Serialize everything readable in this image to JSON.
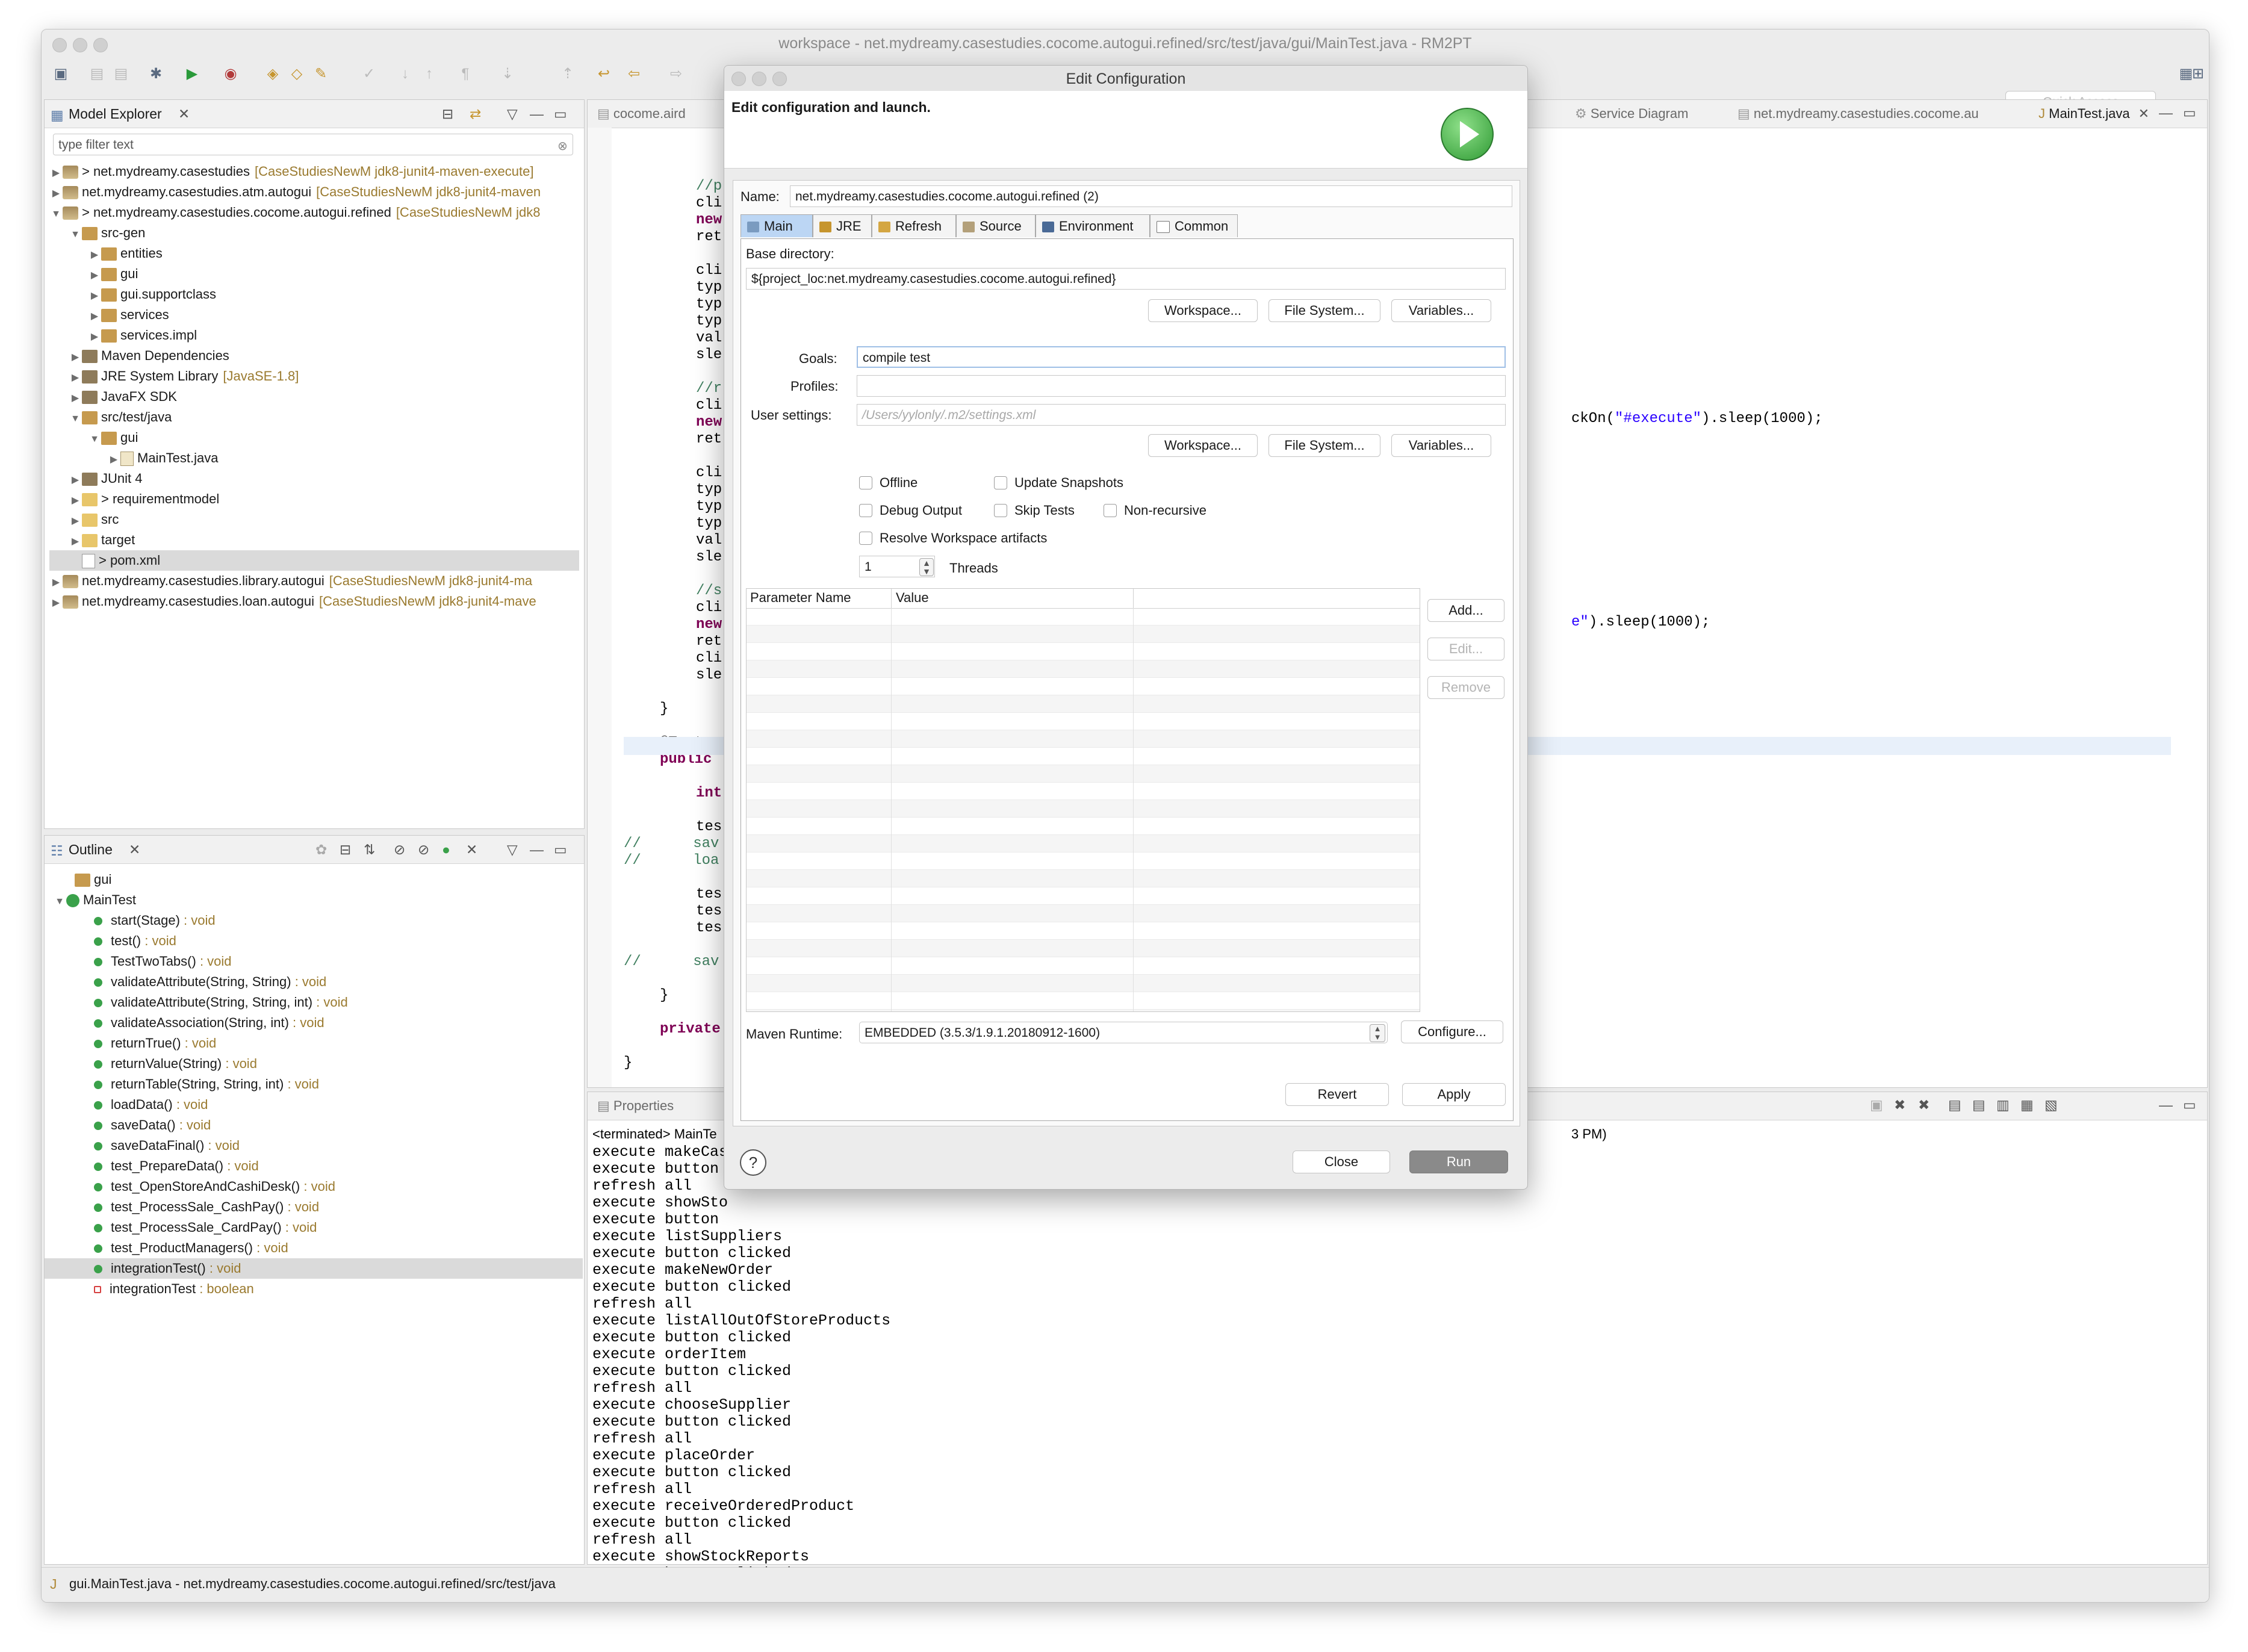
{
  "window": {
    "title": "workspace - net.mydreamy.casestudies.cocome.autogui.refined/src/test/java/gui/MainTest.java - RM2PT",
    "quick_access": "Quick Access"
  },
  "model_explorer": {
    "title": "Model Explorer",
    "filter_placeholder": "type filter text",
    "items": [
      {
        "text": "> net.mydreamy.casestudies",
        "deco": "[CaseStudiesNewM jdk8-junit4-maven-execute]",
        "indent": 0,
        "icon": "proj",
        "tri": "▶"
      },
      {
        "text": "net.mydreamy.casestudies.atm.autogui",
        "deco": "[CaseStudiesNewM jdk8-junit4-maven",
        "indent": 0,
        "icon": "proj",
        "tri": "▶"
      },
      {
        "text": "> net.mydreamy.casestudies.cocome.autogui.refined",
        "deco": "[CaseStudiesNewM jdk8",
        "indent": 0,
        "icon": "proj",
        "tri": "▼"
      },
      {
        "text": "src-gen",
        "deco": "",
        "indent": 1,
        "icon": "pkg",
        "tri": "▼"
      },
      {
        "text": "entities",
        "deco": "",
        "indent": 2,
        "icon": "pkg",
        "tri": "▶"
      },
      {
        "text": "gui",
        "deco": "",
        "indent": 2,
        "icon": "pkg",
        "tri": "▶"
      },
      {
        "text": "gui.supportclass",
        "deco": "",
        "indent": 2,
        "icon": "pkg",
        "tri": "▶"
      },
      {
        "text": "services",
        "deco": "",
        "indent": 2,
        "icon": "pkg",
        "tri": "▶"
      },
      {
        "text": "services.impl",
        "deco": "",
        "indent": 2,
        "icon": "pkg",
        "tri": "▶"
      },
      {
        "text": "Maven Dependencies",
        "deco": "",
        "indent": 1,
        "icon": "lib",
        "tri": "▶"
      },
      {
        "text": "JRE System Library",
        "deco": "[JavaSE-1.8]",
        "indent": 1,
        "icon": "lib",
        "tri": "▶"
      },
      {
        "text": "JavaFX SDK",
        "deco": "",
        "indent": 1,
        "icon": "lib",
        "tri": "▶"
      },
      {
        "text": "src/test/java",
        "deco": "",
        "indent": 1,
        "icon": "pkg",
        "tri": "▼"
      },
      {
        "text": "gui",
        "deco": "",
        "indent": 2,
        "icon": "pkg",
        "tri": "▼"
      },
      {
        "text": "MainTest.java",
        "deco": "",
        "indent": 3,
        "icon": "java",
        "tri": "▶"
      },
      {
        "text": "JUnit 4",
        "deco": "",
        "indent": 1,
        "icon": "lib",
        "tri": "▶"
      },
      {
        "text": "> requirementmodel",
        "deco": "",
        "indent": 1,
        "icon": "folder",
        "tri": "▶"
      },
      {
        "text": "src",
        "deco": "",
        "indent": 1,
        "icon": "folder",
        "tri": "▶"
      },
      {
        "text": "target",
        "deco": "",
        "indent": 1,
        "icon": "folder",
        "tri": "▶"
      },
      {
        "text": "> pom.xml",
        "deco": "",
        "indent": 1,
        "icon": "file",
        "tri": ""
      },
      {
        "text": "net.mydreamy.casestudies.library.autogui",
        "deco": "[CaseStudiesNewM jdk8-junit4-ma",
        "indent": 0,
        "icon": "proj",
        "tri": "▶"
      },
      {
        "text": "net.mydreamy.casestudies.loan.autogui",
        "deco": "[CaseStudiesNewM jdk8-junit4-mave",
        "indent": 0,
        "icon": "proj",
        "tri": "▶"
      }
    ]
  },
  "outline": {
    "title": "Outline",
    "package": "gui",
    "class": "MainTest",
    "members": [
      {
        "name": "start(Stage)",
        "type": " : void",
        "marker": "green"
      },
      {
        "name": "test()",
        "type": " : void",
        "marker": "green"
      },
      {
        "name": "TestTwoTabs()",
        "type": " : void",
        "marker": "green"
      },
      {
        "name": "validateAttribute(String, String)",
        "type": " : void",
        "marker": "green"
      },
      {
        "name": "validateAttribute(String, String, int)",
        "type": " : void",
        "marker": "green"
      },
      {
        "name": "validateAssociation(String, int)",
        "type": " : void",
        "marker": "green"
      },
      {
        "name": "returnTrue()",
        "type": " : void",
        "marker": "green"
      },
      {
        "name": "returnValue(String)",
        "type": " : void",
        "marker": "green"
      },
      {
        "name": "returnTable(String, String, int)",
        "type": " : void",
        "marker": "green"
      },
      {
        "name": "loadData()",
        "type": " : void",
        "marker": "green"
      },
      {
        "name": "saveData()",
        "type": " : void",
        "marker": "green"
      },
      {
        "name": "saveDataFinal()",
        "type": " : void",
        "marker": "green"
      },
      {
        "name": "test_PrepareData()",
        "type": " : void",
        "marker": "green"
      },
      {
        "name": "test_OpenStoreAndCashiDesk()",
        "type": " : void",
        "marker": "green"
      },
      {
        "name": "test_ProcessSale_CashPay()",
        "type": " : void",
        "marker": "green"
      },
      {
        "name": "test_ProcessSale_CardPay()",
        "type": " : void",
        "marker": "green"
      },
      {
        "name": "test_ProductManagers()",
        "type": " : void",
        "marker": "green"
      },
      {
        "name": "integrationTest()",
        "type": " : void",
        "marker": "green"
      },
      {
        "name": "integrationTest",
        "type": " : boolean",
        "marker": "red"
      }
    ]
  },
  "editor_tabs": {
    "left": "cocome.aird",
    "service": "Service Diagram",
    "net": "net.mydreamy.casestudies.cocome.au",
    "active": "MainTest.java"
  },
  "editor": {
    "right_lines": [
      {
        "prefix": "ckOn(",
        "str": "\"#execute\"",
        "suffix": ").sleep(1000);"
      },
      {
        "prefix": "",
        "str": "e\"",
        "suffix": ").sleep(1000);"
      }
    ]
  },
  "console": {
    "properties_tab": "Properties",
    "terminated": "<terminated> MainTe",
    "time_suffix": "3 PM)",
    "lines": [
      "execute makeCas",
      "execute button",
      "refresh all",
      "execute showSto",
      "execute button",
      "execute listSuppliers",
      "execute button clicked",
      "execute makeNewOrder",
      "execute button clicked",
      "refresh all",
      "execute listAllOutOfStoreProducts",
      "execute button clicked",
      "execute orderItem",
      "execute button clicked",
      "refresh all",
      "execute chooseSupplier",
      "execute button clicked",
      "refresh all",
      "execute placeOrder",
      "execute button clicked",
      "refresh all",
      "execute receiveOrderedProduct",
      "execute button clicked",
      "refresh all",
      "execute showStockReports",
      "execute button clicked"
    ]
  },
  "status_bar": {
    "text": "gui.MainTest.java - net.mydreamy.casestudies.cocome.autogui.refined/src/test/java"
  },
  "dialog": {
    "title": "Edit Configuration",
    "header": "Edit configuration and launch.",
    "name_label": "Name:",
    "name_value": "net.mydreamy.casestudies.cocome.autogui.refined (2)",
    "tabs": [
      "Main",
      "JRE",
      "Refresh",
      "Source",
      "Environment",
      "Common"
    ],
    "base_dir_label": "Base directory:",
    "base_dir_value": "${project_loc:net.mydreamy.casestudies.cocome.autogui.refined}",
    "workspace_btn": "Workspace...",
    "filesystem_btn": "File System...",
    "variables_btn": "Variables...",
    "goals_label": "Goals:",
    "goals_value": "compile test",
    "profiles_label": "Profiles:",
    "profiles_value": "",
    "user_settings_label": "User settings:",
    "user_settings_placeholder": "/Users/yylonly/.m2/settings.xml",
    "checkboxes": {
      "offline": "Offline",
      "update_snapshots": "Update Snapshots",
      "debug_output": "Debug Output",
      "skip_tests": "Skip Tests",
      "non_recursive": "Non-recursive",
      "resolve_workspace": "Resolve Workspace artifacts"
    },
    "threads_value": "1",
    "threads_label": "Threads",
    "param_col_name": "Parameter Name",
    "param_col_value": "Value",
    "add_btn": "Add...",
    "edit_btn": "Edit...",
    "remove_btn": "Remove",
    "runtime_label": "Maven Runtime:",
    "runtime_value": "EMBEDDED (3.5.3/1.9.1.20180912-1600)",
    "configure_btn": "Configure...",
    "revert_btn": "Revert",
    "apply_btn": "Apply",
    "close_btn": "Close",
    "run_btn": "Run",
    "help_icon": "?"
  }
}
